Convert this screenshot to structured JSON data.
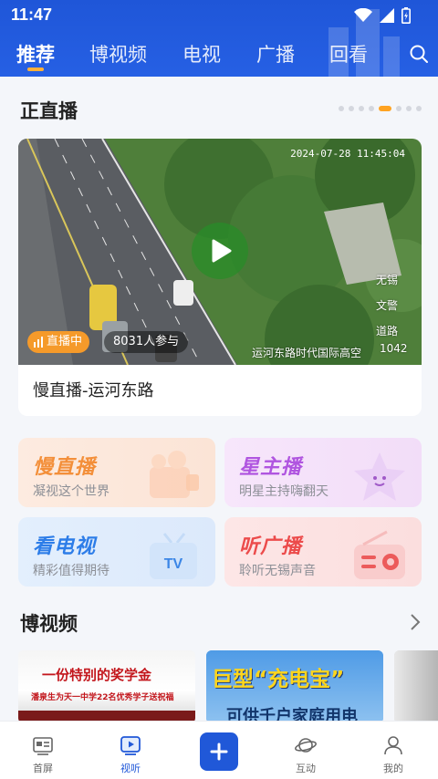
{
  "status_bar": {
    "time": "11:47"
  },
  "tabs": [
    {
      "label": "推荐",
      "active": true
    },
    {
      "label": "博视频",
      "active": false
    },
    {
      "label": "电视",
      "active": false
    },
    {
      "label": "广播",
      "active": false
    },
    {
      "label": "回看",
      "active": false
    }
  ],
  "live_section": {
    "title": "正直播",
    "carousel_total": 8,
    "carousel_active": 5,
    "card": {
      "timestamp": "2024-07-28 11:45:04",
      "badge_live": "直播中",
      "participants": "8031人参与",
      "overlay_lines": [
        "无锡",
        "文警",
        "道路"
      ],
      "overlay_caption": "运河东路时代国际高空",
      "overlay_code": "1042",
      "title": "慢直播-运河东路"
    }
  },
  "categories": [
    {
      "title": "慢直播",
      "subtitle": "凝视这个世界",
      "color": "#f38f3a"
    },
    {
      "title": "星主播",
      "subtitle": "明星主持嗨翻天",
      "color": "#b055e0"
    },
    {
      "title": "看电视",
      "subtitle": "精彩值得期待",
      "color": "#2d7de8"
    },
    {
      "title": "听广播",
      "subtitle": "聆听无锡声音",
      "color": "#ec4b4b"
    }
  ],
  "video_section": {
    "title": "博视频",
    "thumbs": [
      {
        "headline": "一份特别的奖学金",
        "subline": "潘泉生为天一中学22名优秀学子送祝福"
      },
      {
        "headline": "巨型“充电宝”",
        "subline": "可供千户家庭用电"
      }
    ]
  },
  "bottom_nav": [
    {
      "label": "首屏",
      "icon": "home-screen-icon",
      "active": false
    },
    {
      "label": "视听",
      "icon": "play-video-icon",
      "active": true
    },
    {
      "label": "",
      "icon": "plus-icon",
      "active": false
    },
    {
      "label": "互动",
      "icon": "planet-icon",
      "active": false
    },
    {
      "label": "我的",
      "icon": "user-icon",
      "active": false
    }
  ],
  "colors": {
    "brand_blue": "#2058d8",
    "accent_orange": "#ffa322"
  }
}
